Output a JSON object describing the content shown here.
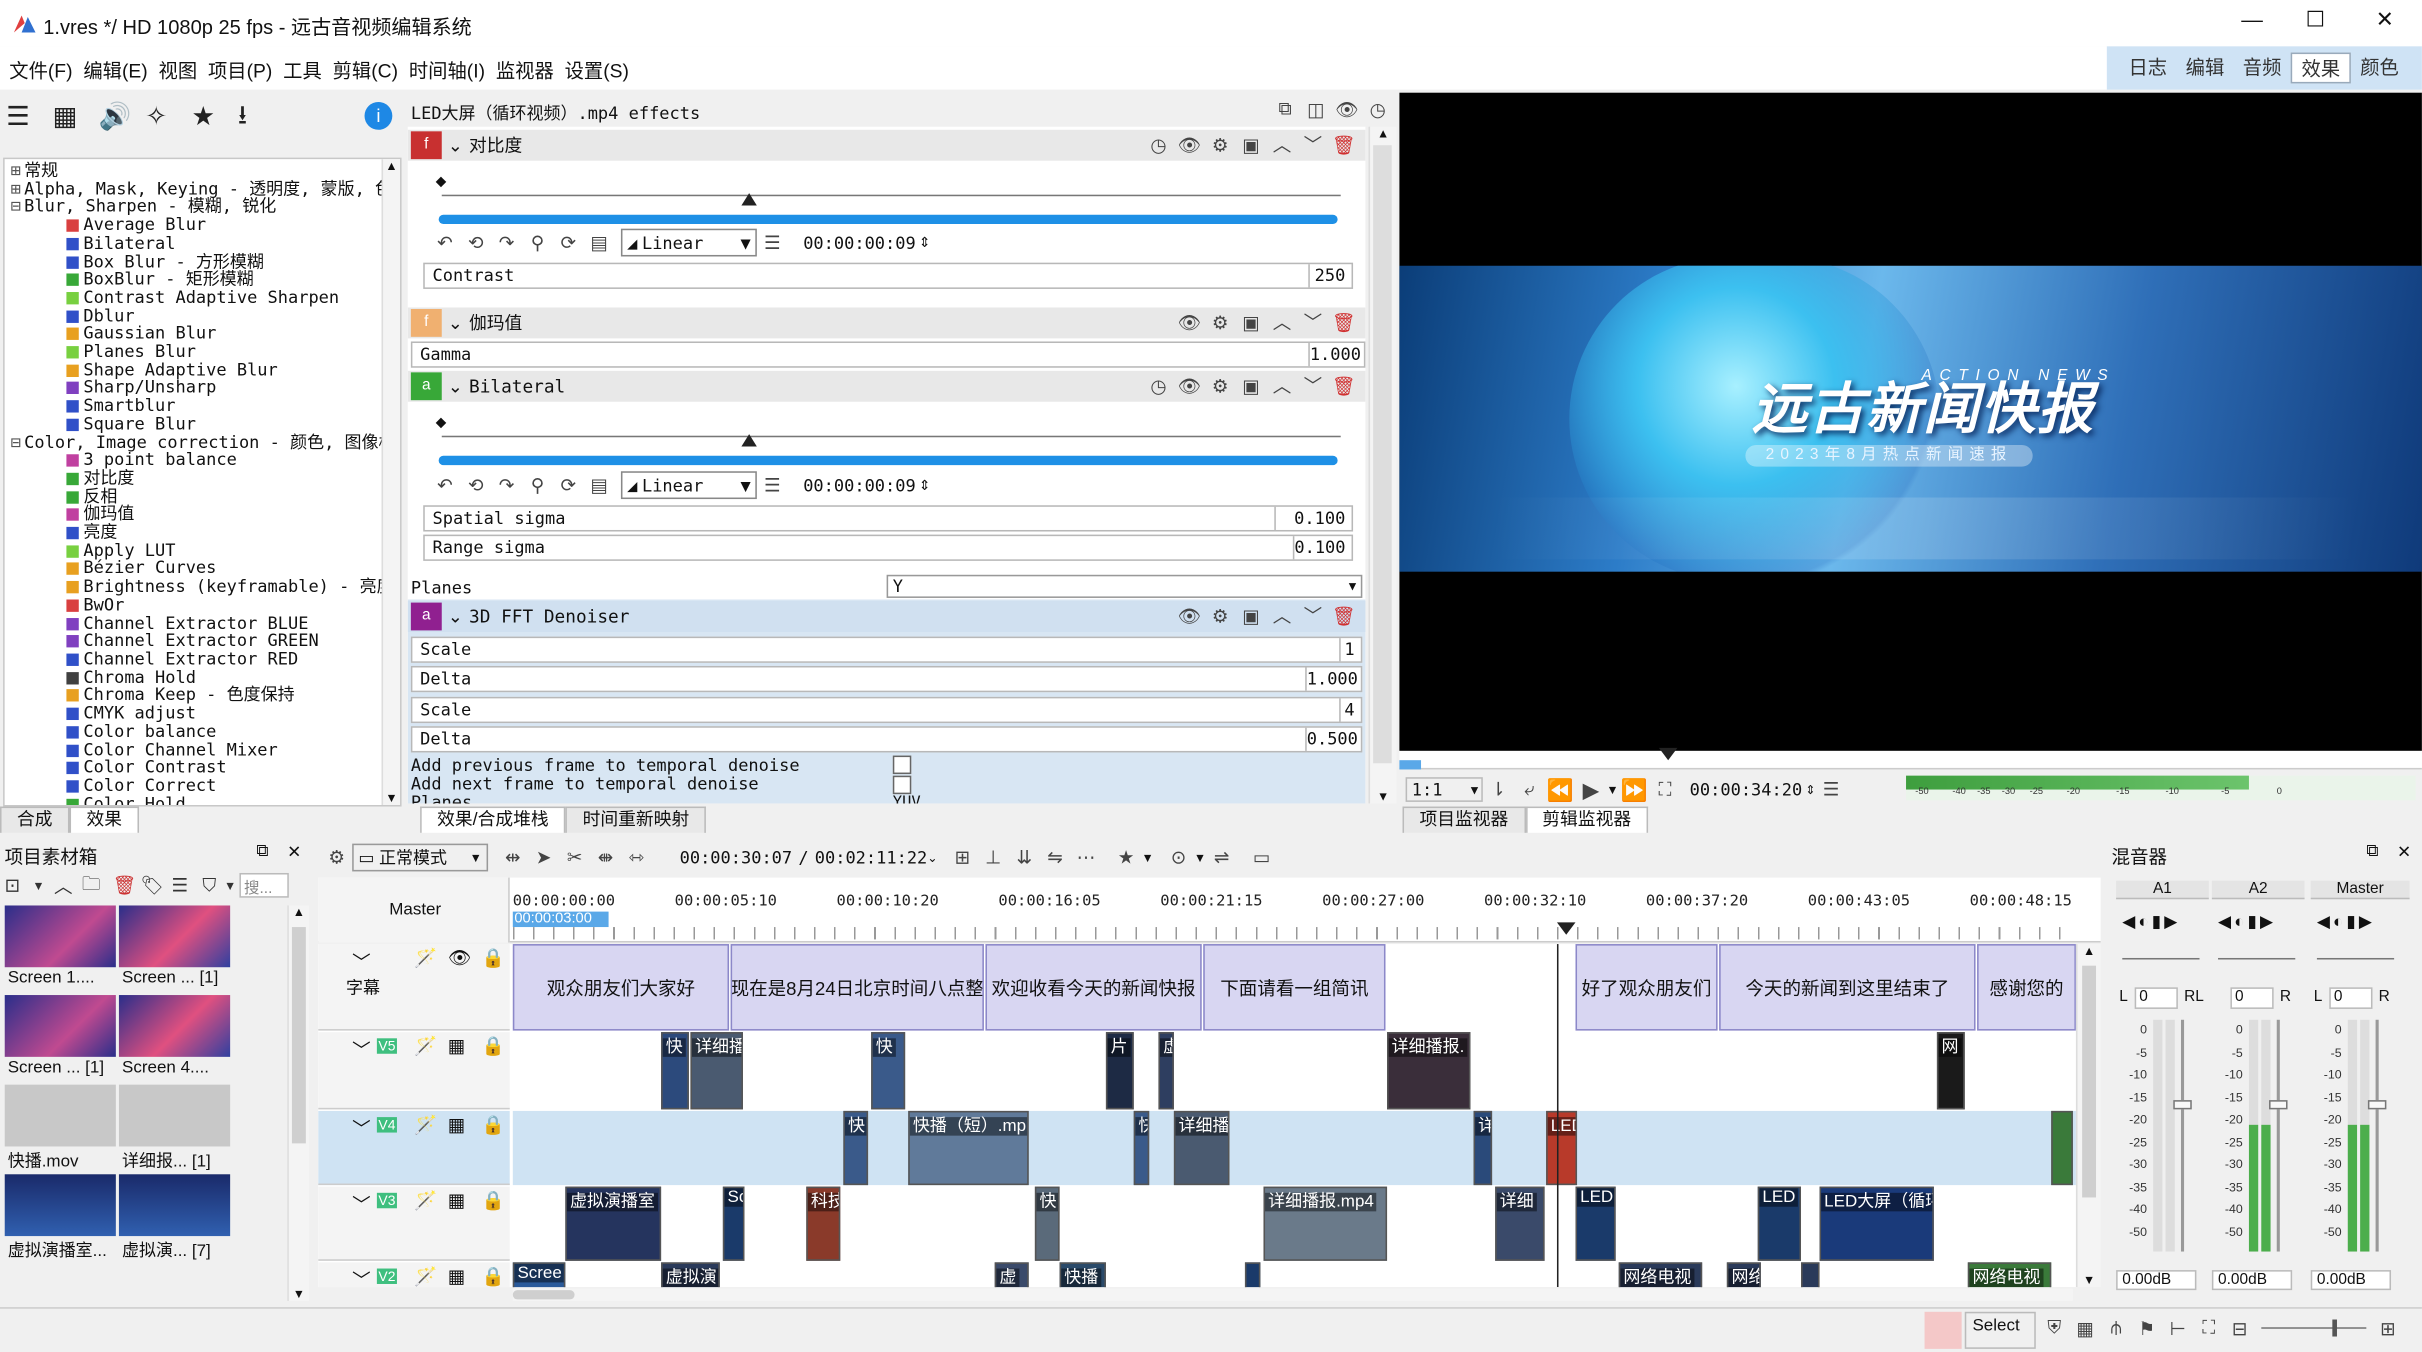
{
  "window": {
    "title": "1.vres */ HD 1080p 25 fps - 远古音视频编辑系统",
    "min": "—",
    "max": "☐",
    "close": "✕"
  },
  "menu": [
    "文件(F)",
    "编辑(E)",
    "视图",
    "项目(P)",
    "工具",
    "剪辑(C)",
    "时间轴(I)",
    "监视器",
    "设置(S)"
  ],
  "workspaces": [
    "日志",
    "编辑",
    "音频",
    "效果",
    "颜色"
  ],
  "active_workspace": "效果",
  "effects_list": {
    "items": [
      {
        "t": "常规",
        "lvl": 0,
        "exp": "⊞"
      },
      {
        "t": "Alpha, Mask, Keying - 透明度, 蒙版, 色",
        "lvl": 0,
        "exp": "⊞"
      },
      {
        "t": "Blur, Sharpen - 模糊, 锐化",
        "lvl": 0,
        "exp": "⊟"
      },
      {
        "t": "Average Blur",
        "lvl": 1,
        "c": "#d94040"
      },
      {
        "t": "Bilateral",
        "lvl": 1,
        "c": "#3050c8"
      },
      {
        "t": "Box Blur - 方形模糊",
        "lvl": 1,
        "c": "#3050c8"
      },
      {
        "t": "BoxBlur - 矩形模糊",
        "lvl": 1,
        "c": "#38a838"
      },
      {
        "t": "Contrast Adaptive Sharpen",
        "lvl": 1,
        "c": "#78d040"
      },
      {
        "t": "Dblur",
        "lvl": 1,
        "c": "#3050c8"
      },
      {
        "t": "Gaussian Blur",
        "lvl": 1,
        "c": "#e8a020"
      },
      {
        "t": "Planes Blur",
        "lvl": 1,
        "c": "#78d040"
      },
      {
        "t": "Shape Adaptive Blur",
        "lvl": 1,
        "c": "#e8a020"
      },
      {
        "t": "Sharp/Unsharp",
        "lvl": 1,
        "c": "#8040c0"
      },
      {
        "t": "Smartblur",
        "lvl": 1,
        "c": "#3050c8"
      },
      {
        "t": "Square Blur",
        "lvl": 1,
        "c": "#3050c8"
      },
      {
        "t": "Color, Image correction - 颜色, 图像校",
        "lvl": 0,
        "exp": "⊟"
      },
      {
        "t": "3 point balance",
        "lvl": 1,
        "c": "#c040a0"
      },
      {
        "t": "对比度",
        "lvl": 1,
        "c": "#38a838"
      },
      {
        "t": "反相",
        "lvl": 1,
        "c": "#38a838"
      },
      {
        "t": "伽玛值",
        "lvl": 1,
        "c": "#c040a0"
      },
      {
        "t": "亮度",
        "lvl": 1,
        "c": "#3050c8"
      },
      {
        "t": "Apply LUT",
        "lvl": 1,
        "c": "#78d040"
      },
      {
        "t": "Bézier Curves",
        "lvl": 1,
        "c": "#e8a020"
      },
      {
        "t": "Brightness (keyframable) - 亮度 (",
        "lvl": 1,
        "c": "#e8a020"
      },
      {
        "t": "BwOr",
        "lvl": 1,
        "c": "#d94040"
      },
      {
        "t": "Channel Extractor BLUE",
        "lvl": 1,
        "c": "#8040c0"
      },
      {
        "t": "Channel Extractor GREEN",
        "lvl": 1,
        "c": "#8040c0"
      },
      {
        "t": "Channel Extractor RED",
        "lvl": 1,
        "c": "#3050c8"
      },
      {
        "t": "Chroma Hold",
        "lvl": 1,
        "c": "#404040"
      },
      {
        "t": "Chroma Keep - 色度保持",
        "lvl": 1,
        "c": "#e8a020"
      },
      {
        "t": "CMYK adjust",
        "lvl": 1,
        "c": "#3050c8"
      },
      {
        "t": "Color balance",
        "lvl": 1,
        "c": "#3050c8"
      },
      {
        "t": "Color Channel Mixer",
        "lvl": 1,
        "c": "#3050c8"
      },
      {
        "t": "Color Contrast",
        "lvl": 1,
        "c": "#3050c8"
      },
      {
        "t": "Color Correct",
        "lvl": 1,
        "c": "#3050c8"
      },
      {
        "t": "Color Hold",
        "lvl": 1,
        "c": "#38a838"
      }
    ],
    "tabs": [
      "合成",
      "效果"
    ]
  },
  "effect_stack": {
    "title": "LED大屏（循环视频）.mp4 effects",
    "contrast": {
      "badge": "f",
      "name": "对比度",
      "interp": "Linear",
      "time": "00:00:00:09",
      "param": "Contrast",
      "value": "250"
    },
    "gamma": {
      "badge": "f",
      "name": "伽玛值",
      "param": "Gamma",
      "value": "1.000"
    },
    "bilateral": {
      "badge": "a",
      "name": "Bilateral",
      "interp": "Linear",
      "time": "00:00:00:09",
      "p1": "Spatial sigma",
      "v1": "0.100",
      "p2": "Range sigma",
      "v2": "0.100",
      "planes_label": "Planes",
      "planes_value": "Y"
    },
    "fft": {
      "badge": "a",
      "name": "3D FFT Denoiser",
      "p1": "Scale",
      "v1": "1",
      "p2": "Delta",
      "v2": "1.000",
      "p3": "Scale",
      "v3": "4",
      "p4": "Delta",
      "v4": "0.500",
      "c1": "Add previous frame to temporal denoise",
      "c2": "Add next frame to temporal denoise",
      "p5": "Planes",
      "v5": "YUV"
    },
    "tabs": [
      "效果/合成堆栈",
      "时间重新映射"
    ]
  },
  "monitor": {
    "title_cn": "远古新闻快报",
    "title_en": "ACTION NEWS",
    "subtitle": "2023年8月热点新闻速报",
    "zoom": "1:1",
    "timecode": "00:00:34:20",
    "meter_ticks": [
      "-50",
      "-40",
      "-35",
      "-30",
      "-25",
      "-20",
      "-15",
      "-10",
      "-5",
      "0"
    ],
    "tabs": [
      "项目监视器",
      "剪辑监视器"
    ]
  },
  "bin": {
    "title": "项目素材箱",
    "search_placeholder": "搜...",
    "items": [
      {
        "label": "Screen 1....",
        "th": "a"
      },
      {
        "label": "Screen ... [1]",
        "th": "b"
      },
      {
        "label": "Screen ... [1]",
        "th": "a"
      },
      {
        "label": "Screen 4....",
        "th": "b"
      },
      {
        "label": "快播.mov",
        "th": "g"
      },
      {
        "label": "详细报... [1]",
        "th": "g"
      },
      {
        "label": "虚拟演播室...",
        "th": "d"
      },
      {
        "label": "虚拟演... [7]",
        "th": "d"
      }
    ]
  },
  "timeline": {
    "mode": "正常模式",
    "position": "00:00:30:07",
    "duration": "00:02:11:22",
    "master": "Master",
    "zone": "00:00:03:00",
    "ticks": [
      "00:00:00:00",
      "00:00:05:10",
      "00:00:10:20",
      "00:00:16:05",
      "00:00:21:15",
      "00:00:27:00",
      "00:00:32:10",
      "00:00:37:20",
      "00:00:43:05",
      "00:00:48:15"
    ],
    "tracks": [
      "字幕",
      "V5",
      "V4",
      "V3",
      "V2"
    ],
    "subtitles": [
      "观众朋友们大家好",
      "现在是8月24日北京时间八点整",
      "欢迎收看今天的新闻快报",
      "下面请看一组简讯",
      "好了观众朋友们",
      "今天的新闻到这里结束了",
      "感谢您的"
    ],
    "v5": [
      "快",
      "详细播",
      "快",
      "片",
      "虚",
      "详细播报.",
      "网"
    ],
    "v4": [
      "快",
      "快播（短）.mp",
      "快",
      "详细播",
      "详",
      "LED 对比"
    ],
    "v3": [
      "虚拟演播室",
      "Sc",
      "科技",
      "快",
      "详细播报.mp4",
      "详细",
      "LED",
      "LED",
      "LED大屏（循环"
    ],
    "v2": [
      "Scree",
      "虚拟演",
      "虚",
      "快播",
      "网络电视",
      "网络",
      "网络电视"
    ]
  },
  "mixer": {
    "title": "混音器",
    "channels": [
      {
        "name": "A1",
        "l": "L",
        "val": "0",
        "r": "RL",
        "db": "0.00dB"
      },
      {
        "name": "A2",
        "l": "",
        "val": "0",
        "r": "R",
        "db": "0.00dB"
      },
      {
        "name": "Master",
        "l": "L",
        "val": "0",
        "r": "R",
        "db": "0.00dB"
      }
    ],
    "scale": [
      "0",
      "-5",
      "-10",
      "-15",
      "-20",
      "-25",
      "-30",
      "-35",
      "-40",
      "-50"
    ]
  },
  "status": {
    "select": "Select"
  }
}
